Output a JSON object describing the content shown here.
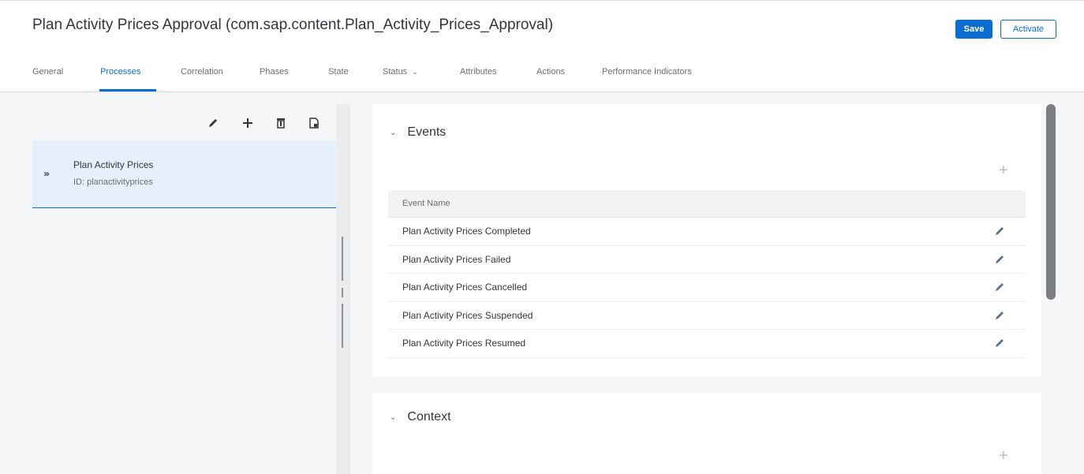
{
  "header": {
    "title": "Plan Activity Prices Approval (com.sap.content.Plan_Activity_Prices_Approval)",
    "save_label": "Save",
    "activate_label": "Activate"
  },
  "tabs": [
    {
      "label": "General"
    },
    {
      "label": "Processes"
    },
    {
      "label": "Correlation"
    },
    {
      "label": "Phases"
    },
    {
      "label": "State"
    },
    {
      "label": "Status"
    },
    {
      "label": "Attributes"
    },
    {
      "label": "Actions"
    },
    {
      "label": "Performance Indicators"
    }
  ],
  "active_tab": "Processes",
  "master": {
    "toolbar": [
      "edit-icon",
      "add-icon",
      "delete-icon",
      "copy-icon"
    ],
    "items": [
      {
        "name": "Plan Activity Prices",
        "id": "ID: planactivityprices"
      }
    ]
  },
  "events": {
    "title": "Events",
    "column_header": "Event Name",
    "rows": [
      {
        "name": "Plan Activity Prices Completed"
      },
      {
        "name": "Plan Activity Prices Failed"
      },
      {
        "name": "Plan Activity Prices Cancelled"
      },
      {
        "name": "Plan Activity Prices Suspended"
      },
      {
        "name": "Plan Activity Prices Resumed"
      }
    ]
  },
  "context": {
    "title": "Context"
  },
  "colors": {
    "accent": "#0a6ed1",
    "selection": "#e5f0fa",
    "background": "#f5f6f7"
  }
}
